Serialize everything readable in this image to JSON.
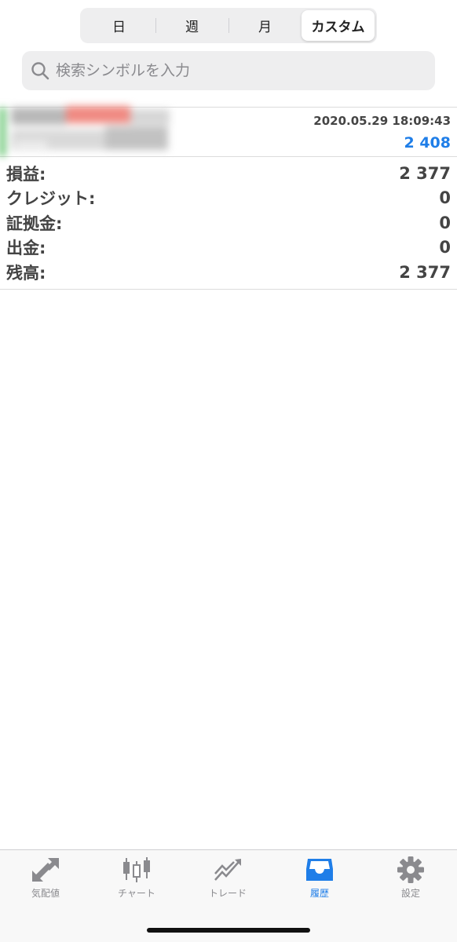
{
  "period_tabs": [
    {
      "label": "日",
      "active": false
    },
    {
      "label": "週",
      "active": false
    },
    {
      "label": "月",
      "active": false
    },
    {
      "label": "カスタム",
      "active": true
    }
  ],
  "search": {
    "placeholder": "検索シンボルを入力",
    "value": ""
  },
  "account_row": {
    "datetime": "2020.05.29 18:09:43",
    "value": "2 408",
    "value_color": "#1f7ee8"
  },
  "summary": [
    {
      "label": "損益:",
      "value": "2 377"
    },
    {
      "label": "クレジット:",
      "value": "0"
    },
    {
      "label": "証拠金:",
      "value": "0"
    },
    {
      "label": "出金:",
      "value": "0"
    },
    {
      "label": "残高:",
      "value": "2 377"
    }
  ],
  "tabbar": [
    {
      "label": "気配値",
      "icon": "quotes-arrows-icon",
      "active": false
    },
    {
      "label": "チャート",
      "icon": "candlestick-chart-icon",
      "active": false
    },
    {
      "label": "トレード",
      "icon": "trade-trend-icon",
      "active": false
    },
    {
      "label": "履歴",
      "icon": "history-inbox-icon",
      "active": true
    },
    {
      "label": "設定",
      "icon": "gear-icon",
      "active": false
    }
  ],
  "colors": {
    "accent": "#1f7ee8",
    "inactive": "#8a8a8e"
  }
}
